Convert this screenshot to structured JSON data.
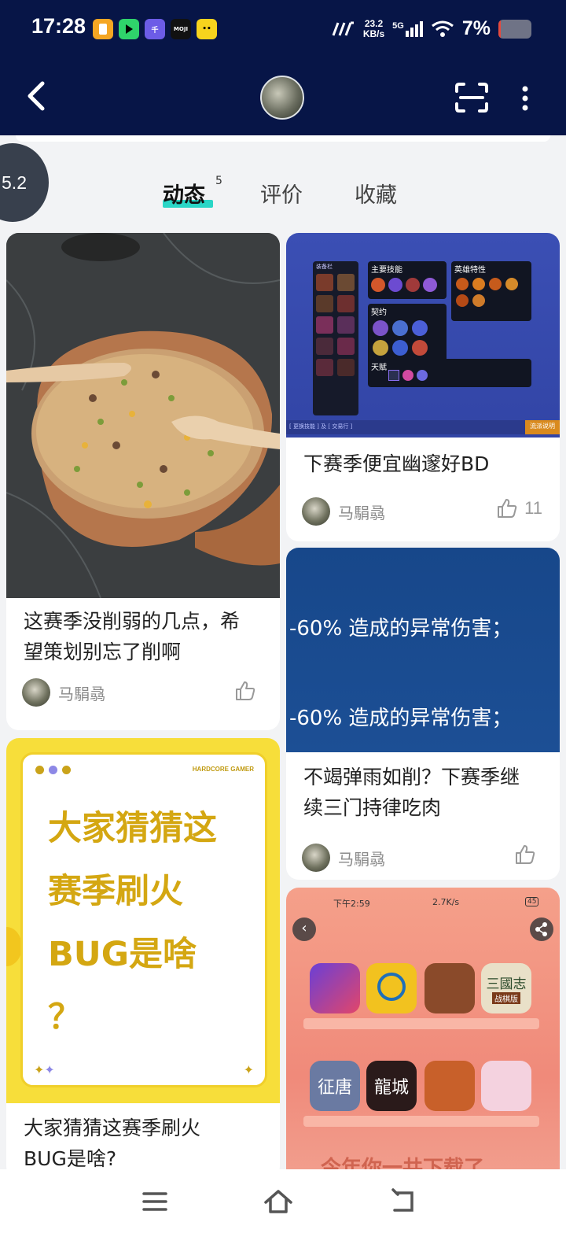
{
  "status_bar": {
    "time": "17:28",
    "net_speed_value": "23.2",
    "net_speed_unit": "KB/s",
    "network": "5G",
    "battery_pct": "7%",
    "battery_level": 0.07,
    "app_icons": [
      "memo-icon",
      "play-icon",
      "qianfan-icon",
      "moji-icon",
      "chat-icon"
    ]
  },
  "header": {
    "back_icon": "back-arrow-icon",
    "scan_icon": "scan-icon",
    "more_icon": "more-vertical-icon"
  },
  "rating": "5.2",
  "tabs": [
    {
      "label": "动态",
      "count": "5",
      "active": true
    },
    {
      "label": "评价",
      "active": false
    },
    {
      "label": "收藏",
      "active": false
    }
  ],
  "feed": {
    "left": [
      {
        "title_line1": "这赛季没削弱的几点，希",
        "title_line2": "望策划别忘了削啊",
        "author": "马駽骉",
        "likes": ""
      },
      {
        "poster_brand": "HARDCORE GAMER",
        "poster_line1": "大家猜猜这",
        "poster_line2": "赛季刷火",
        "poster_line3": "BUG是啥",
        "poster_line4": "？",
        "title_line1": "大家猜猜这赛季刷火",
        "title_line2": "BUG是啥?"
      }
    ],
    "right": [
      {
        "game_panel": {
          "section1": "主要技能",
          "section2": "英雄特性",
          "section3": "契约",
          "section4": "天赋",
          "left_label": "装备栏",
          "bottom_left": "[ 更换技能 ] 及 [ 交易行 ]",
          "bottom_right": "流派说明"
        },
        "title": "下赛季便宜幽邃好BD",
        "author": "马駽骉",
        "likes": "11"
      },
      {
        "banner_line1": "-60% 造成的异常伤害；",
        "banner_line2": "-60% 造成的异常伤害；",
        "title_line1": "不竭弹雨如削？下赛季继",
        "title_line2": "续三门持律吃肉",
        "author": "马駽骉",
        "likes": ""
      },
      {
        "screenshot_time": "下午2:59",
        "screenshot_speed": "2.7K/s",
        "screenshot_battery": "45",
        "caption": "今年你一共下载了",
        "app_label_1": "三國志",
        "app_label_2": "战棋版",
        "app_label_3": "征唐",
        "app_label_4": "龍城"
      }
    ]
  },
  "nav": {
    "menu_icon": "menu-icon",
    "home_icon": "home-icon",
    "back_icon": "return-icon"
  }
}
